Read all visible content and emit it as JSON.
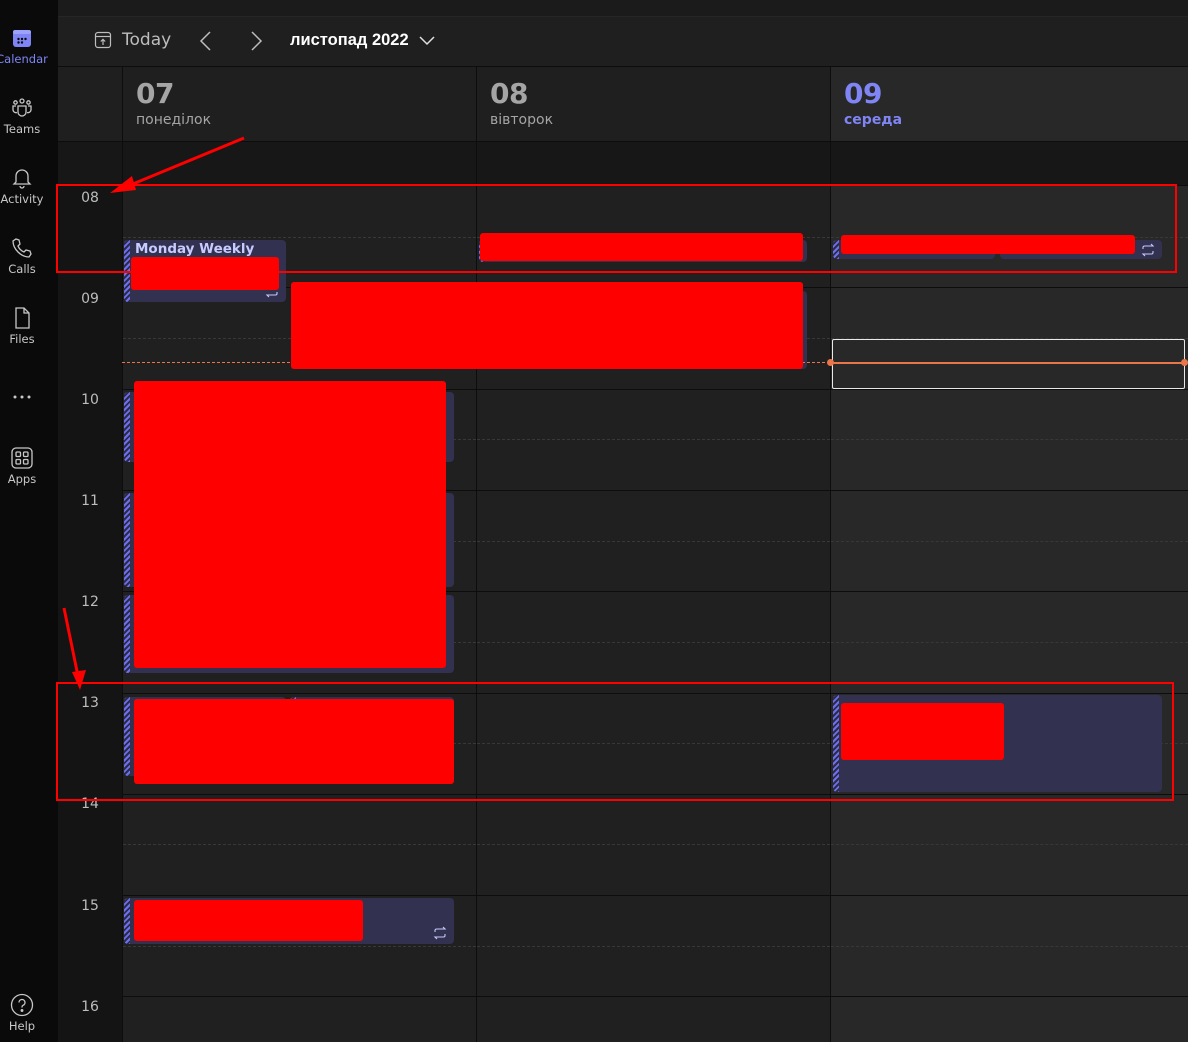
{
  "rail": {
    "items": [
      {
        "label": "Calendar",
        "icon": "calendar-icon",
        "active": true
      },
      {
        "label": "Teams",
        "icon": "teams-icon"
      },
      {
        "label": "Activity",
        "icon": "bell-icon"
      },
      {
        "label": "Calls",
        "icon": "phone-icon"
      },
      {
        "label": "Files",
        "icon": "file-icon"
      },
      {
        "label": "",
        "icon": "more-icon"
      },
      {
        "label": "Apps",
        "icon": "apps-icon"
      }
    ],
    "help": {
      "label": "Help",
      "icon": "help-icon"
    }
  },
  "toolbar": {
    "today_label": "Today",
    "month_label": "листопад 2022",
    "icons": {
      "today": "calendar-today-icon",
      "prev": "chevron-left-icon",
      "next": "chevron-right-icon",
      "month_dropdown": "chevron-down-icon"
    }
  },
  "days": [
    {
      "num": "07",
      "name": "понеділок",
      "today": false
    },
    {
      "num": "08",
      "name": "вівторок",
      "today": false
    },
    {
      "num": "09",
      "name": "середа",
      "today": true
    }
  ],
  "hours": [
    "08",
    "09",
    "10",
    "11",
    "12",
    "13",
    "14",
    "15",
    "16"
  ],
  "events": {
    "monday_weekly_title": "Monday Weekly",
    "recurring_icon": "recurring-icon"
  },
  "colors": {
    "accent": "#7f85f5",
    "event_bg": "#32314f",
    "now_line": "#e97548",
    "annotation": "#ff0000"
  }
}
